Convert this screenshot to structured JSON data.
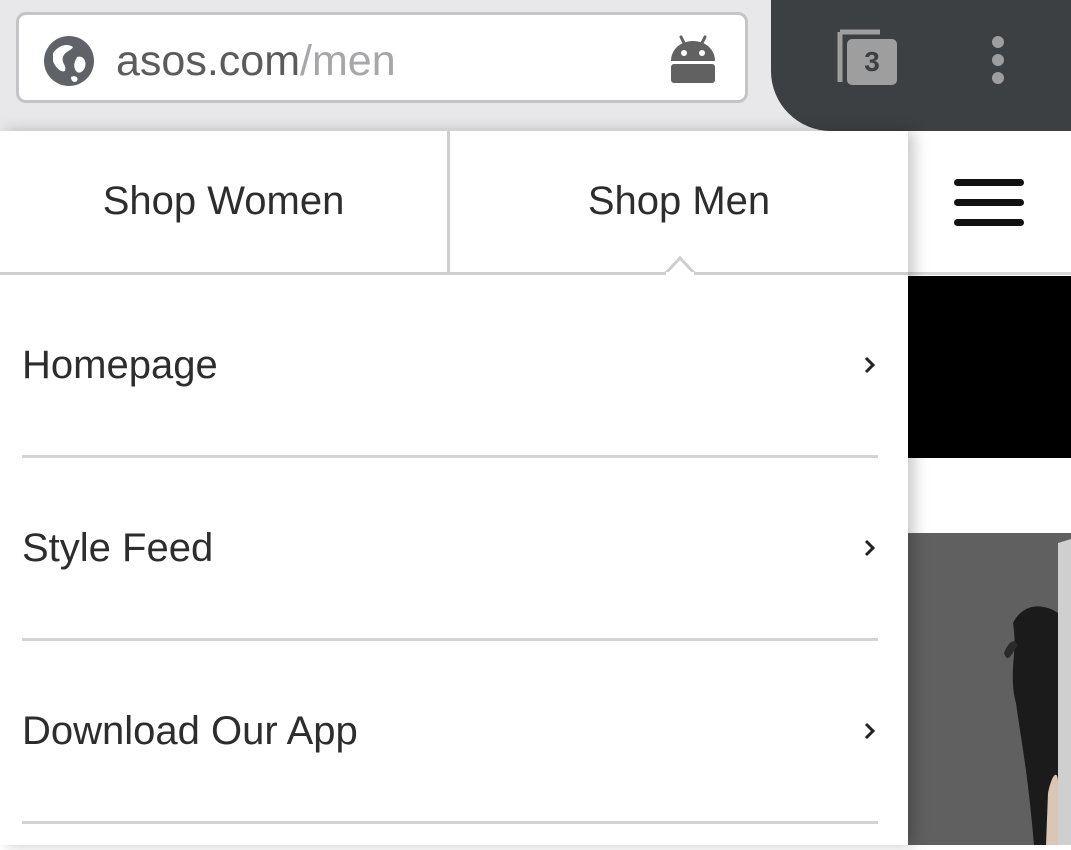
{
  "browser": {
    "url_domain": "asos.com",
    "url_path": "/men",
    "tab_count": "3",
    "icons": [
      "globe-icon",
      "android-icon",
      "tabs-icon",
      "overflow-menu-icon"
    ],
    "colors": {
      "toolbar": "#e8e8ea",
      "dark_toolbar": "#3c4043"
    }
  },
  "drawer": {
    "tabs": [
      {
        "label": "Shop Women",
        "selected": false
      },
      {
        "label": "Shop Men",
        "selected": true
      }
    ],
    "items": [
      {
        "label": "Homepage"
      },
      {
        "label": "Style Feed"
      },
      {
        "label": "Download Our App"
      }
    ]
  },
  "page": {
    "icons": [
      "hamburger-menu-icon"
    ]
  }
}
